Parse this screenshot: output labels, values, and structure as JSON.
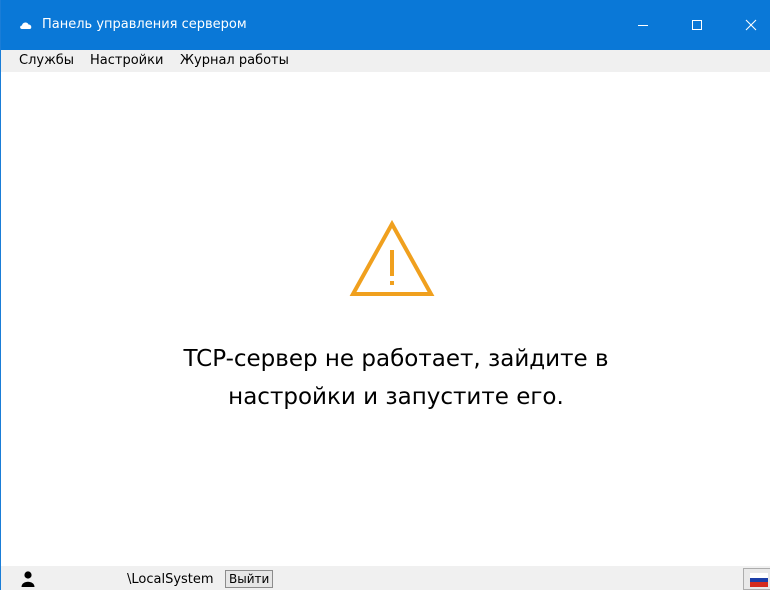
{
  "window": {
    "title": "Панель управления сервером"
  },
  "menu": {
    "items": [
      {
        "label": "Службы"
      },
      {
        "label": "Настройки"
      },
      {
        "label": "Журнал работы"
      }
    ]
  },
  "main": {
    "message_line1": "TCP-сервер не работает, зайдите в",
    "message_line2": "настройки и запустите его.",
    "warning_color": "#f0a01e"
  },
  "status": {
    "user_suffix": "\\LocalSystem",
    "logout_label": "Выйти",
    "language_flag": "flag-ru-icon"
  },
  "colors": {
    "titlebar": "#0a78d7",
    "accent": "#0a78d7"
  }
}
